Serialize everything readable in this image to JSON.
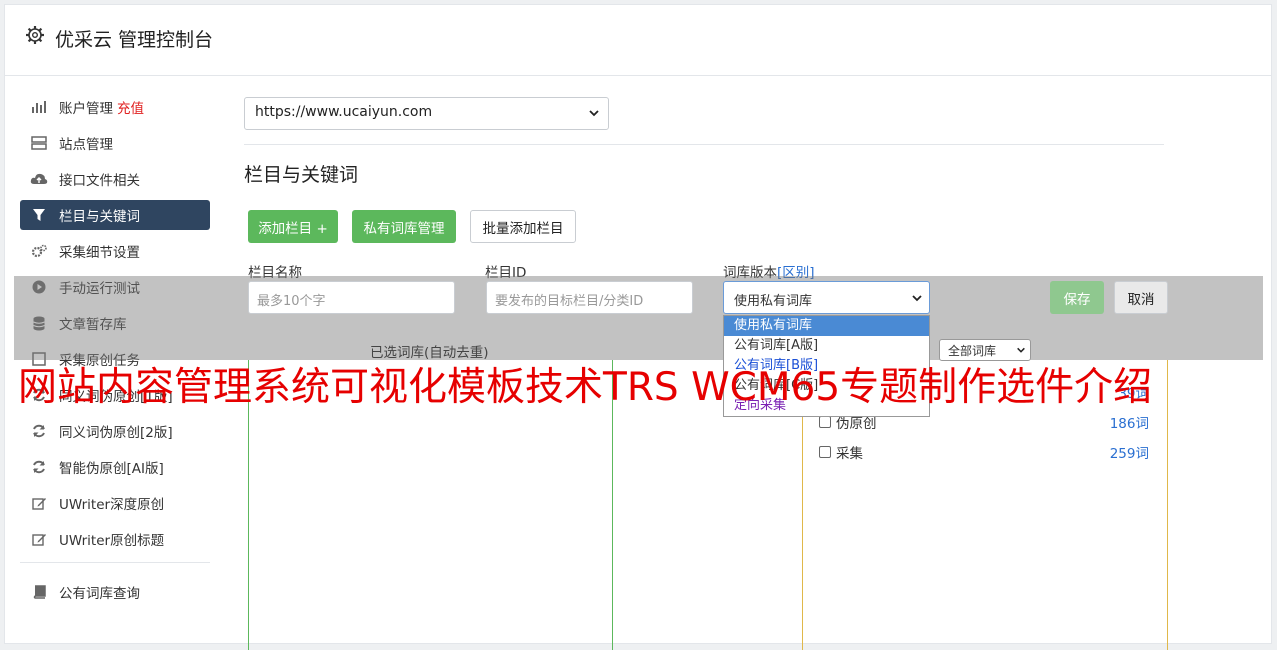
{
  "header": {
    "title": "优采云 管理控制台",
    "icon": "gear-icon"
  },
  "sidebar": {
    "items": [
      {
        "label": "账户管理",
        "extra": "充值",
        "icon": "bar-chart-icon"
      },
      {
        "label": "站点管理",
        "icon": "server-icon"
      },
      {
        "label": "接口文件相关",
        "icon": "cloud-upload-icon"
      },
      {
        "label": "栏目与关键词",
        "icon": "filter-icon",
        "active": true
      },
      {
        "label": "采集细节设置",
        "icon": "cogs-icon"
      },
      {
        "label": "手动运行测试",
        "icon": "play-circle-icon"
      },
      {
        "label": "文章暂存库",
        "icon": "database-icon"
      },
      {
        "label": "采集原创任务",
        "icon": "task-icon"
      },
      {
        "label": "同义词伪原创[1版]",
        "icon": "refresh-icon"
      },
      {
        "label": "同义词伪原创[2版]",
        "icon": "refresh-icon"
      },
      {
        "label": "智能伪原创[AI版]",
        "icon": "refresh-icon"
      },
      {
        "label": "UWriter深度原创",
        "icon": "edit-icon"
      },
      {
        "label": "UWriter原创标题",
        "icon": "edit-icon"
      },
      {
        "label": "公有词库查询",
        "icon": "book-icon"
      }
    ],
    "accent": "#2f4560"
  },
  "main": {
    "site_select": "https://www.ucaiyun.com",
    "section_title": "栏目与关键词",
    "buttons": {
      "add_column": "添加栏目 +",
      "private_lib": "私有词库管理",
      "batch_add": "批量添加栏目"
    },
    "form": {
      "name_label": "栏目名称",
      "name_placeholder": "最多10个字",
      "id_label": "栏目ID",
      "id_placeholder": "要发布的目标栏目/分类ID",
      "version_label": "词库版本",
      "version_link": "[区别]",
      "version_value": "使用私有词库",
      "version_options": [
        "使用私有词库",
        "公有词库[A版]",
        "公有词库[B版]",
        "公有词库[C版]",
        "定向采集"
      ],
      "save": "保存",
      "cancel": "取消"
    },
    "selected_lib_label": "已选词库(自动去重)",
    "all_lib_filter": "全部词库",
    "libraries": [
      {
        "name": "伪原创",
        "count": "186词"
      },
      {
        "name": "采集",
        "count": "259词"
      }
    ],
    "partial_count": "39词"
  },
  "banner": "网站内容管理系统可视化模板技术TRS WCM65专题制作选件介绍",
  "colors": {
    "green": "#5cb85c",
    "red": "#e60000",
    "link": "#2a6fd1"
  }
}
